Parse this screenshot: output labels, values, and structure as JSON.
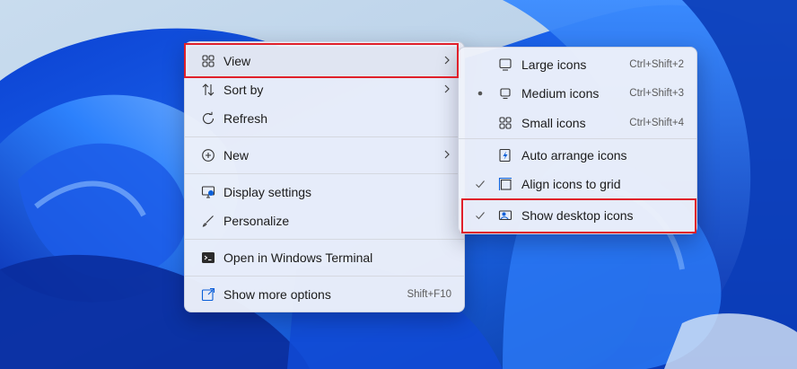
{
  "context_menu": {
    "items": [
      {
        "label": "View",
        "icon": "grid-four-icon",
        "has_submenu": true
      },
      {
        "label": "Sort by",
        "icon": "sort-arrows-icon",
        "has_submenu": true
      },
      {
        "label": "Refresh",
        "icon": "refresh-icon",
        "has_submenu": false
      },
      {
        "label": "New",
        "icon": "plus-circle-icon",
        "has_submenu": true
      },
      {
        "label": "Display settings",
        "icon": "display-icon",
        "has_submenu": false
      },
      {
        "label": "Personalize",
        "icon": "brush-icon",
        "has_submenu": false
      },
      {
        "label": "Open in Windows Terminal",
        "icon": "terminal-icon",
        "has_submenu": false
      },
      {
        "label": "Show more options",
        "icon": "open-external-icon",
        "shortcut": "Shift+F10"
      }
    ]
  },
  "view_submenu": {
    "items": [
      {
        "label": "Large icons",
        "icon": "monitor-large-icon",
        "shortcut": "Ctrl+Shift+2",
        "state": "none"
      },
      {
        "label": "Medium icons",
        "icon": "monitor-medium-icon",
        "shortcut": "Ctrl+Shift+3",
        "state": "selected-dot"
      },
      {
        "label": "Small icons",
        "icon": "grid-four-icon",
        "shortcut": "Ctrl+Shift+4",
        "state": "none"
      },
      {
        "label": "Auto arrange icons",
        "icon": "auto-arrange-icon",
        "state": "none"
      },
      {
        "label": "Align icons to grid",
        "icon": "align-grid-icon",
        "state": "checked"
      },
      {
        "label": "Show desktop icons",
        "icon": "show-desktop-icon",
        "state": "checked"
      }
    ]
  },
  "colors": {
    "highlight_border": "#e0202a",
    "menu_background": "#eef1fa",
    "accent_blue": "#0a5fd8"
  }
}
